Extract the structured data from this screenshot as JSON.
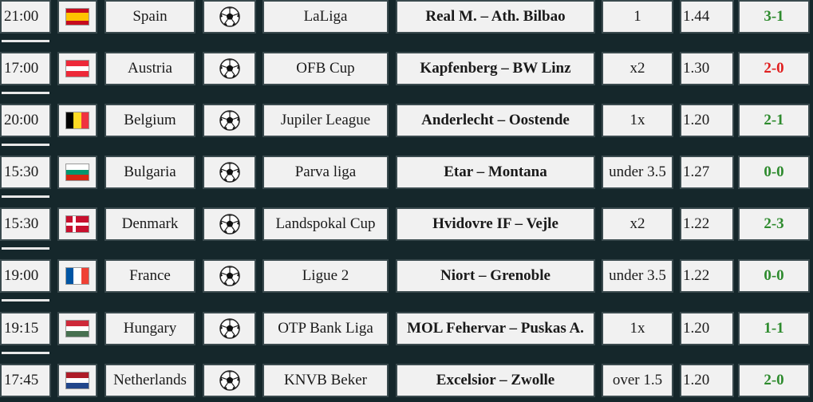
{
  "colors": {
    "background": "#15272b",
    "cell": "#f1f1f1",
    "win": "#2e8b2e",
    "loss": "#e02020"
  },
  "sport_icon": "soccer-ball-icon",
  "matches": [
    {
      "time": "21:00",
      "country": "Spain",
      "flag_icon": "spain-flag-icon",
      "league": "LaLiga",
      "match": "Real M. – Ath. Bilbao",
      "tip": "1",
      "odds": "1.44",
      "result": "3-1",
      "status": "win"
    },
    {
      "time": "17:00",
      "country": "Austria",
      "flag_icon": "austria-flag-icon",
      "league": "OFB Cup",
      "match": "Kapfenberg – BW Linz",
      "tip": "x2",
      "odds": "1.30",
      "result": "2-0",
      "status": "loss"
    },
    {
      "time": "20:00",
      "country": "Belgium",
      "flag_icon": "belgium-flag-icon",
      "league": "Jupiler League",
      "match": "Anderlecht – Oostende",
      "tip": "1x",
      "odds": "1.20",
      "result": "2-1",
      "status": "win"
    },
    {
      "time": "15:30",
      "country": "Bulgaria",
      "flag_icon": "bulgaria-flag-icon",
      "league": "Parva liga",
      "match": "Etar – Montana",
      "tip": "under 3.5",
      "odds": "1.27",
      "result": "0-0",
      "status": "win"
    },
    {
      "time": "15:30",
      "country": "Denmark",
      "flag_icon": "denmark-flag-icon",
      "league": "Landspokal Cup",
      "match": "Hvidovre IF – Vejle",
      "tip": "x2",
      "odds": "1.22",
      "result": "2-3",
      "status": "win"
    },
    {
      "time": "19:00",
      "country": "France",
      "flag_icon": "france-flag-icon",
      "league": "Ligue 2",
      "match": "Niort – Grenoble",
      "tip": "under 3.5",
      "odds": "1.22",
      "result": "0-0",
      "status": "win"
    },
    {
      "time": "19:15",
      "country": "Hungary",
      "flag_icon": "hungary-flag-icon",
      "league": "OTP Bank Liga",
      "match": "MOL Fehervar – Puskas A.",
      "tip": "1x",
      "odds": "1.20",
      "result": "1-1",
      "status": "win"
    },
    {
      "time": "17:45",
      "country": "Netherlands",
      "flag_icon": "netherlands-flag-icon",
      "league": "KNVB Beker",
      "match": "Excelsior – Zwolle",
      "tip": "over 1.5",
      "odds": "1.20",
      "result": "2-0",
      "status": "win"
    }
  ]
}
